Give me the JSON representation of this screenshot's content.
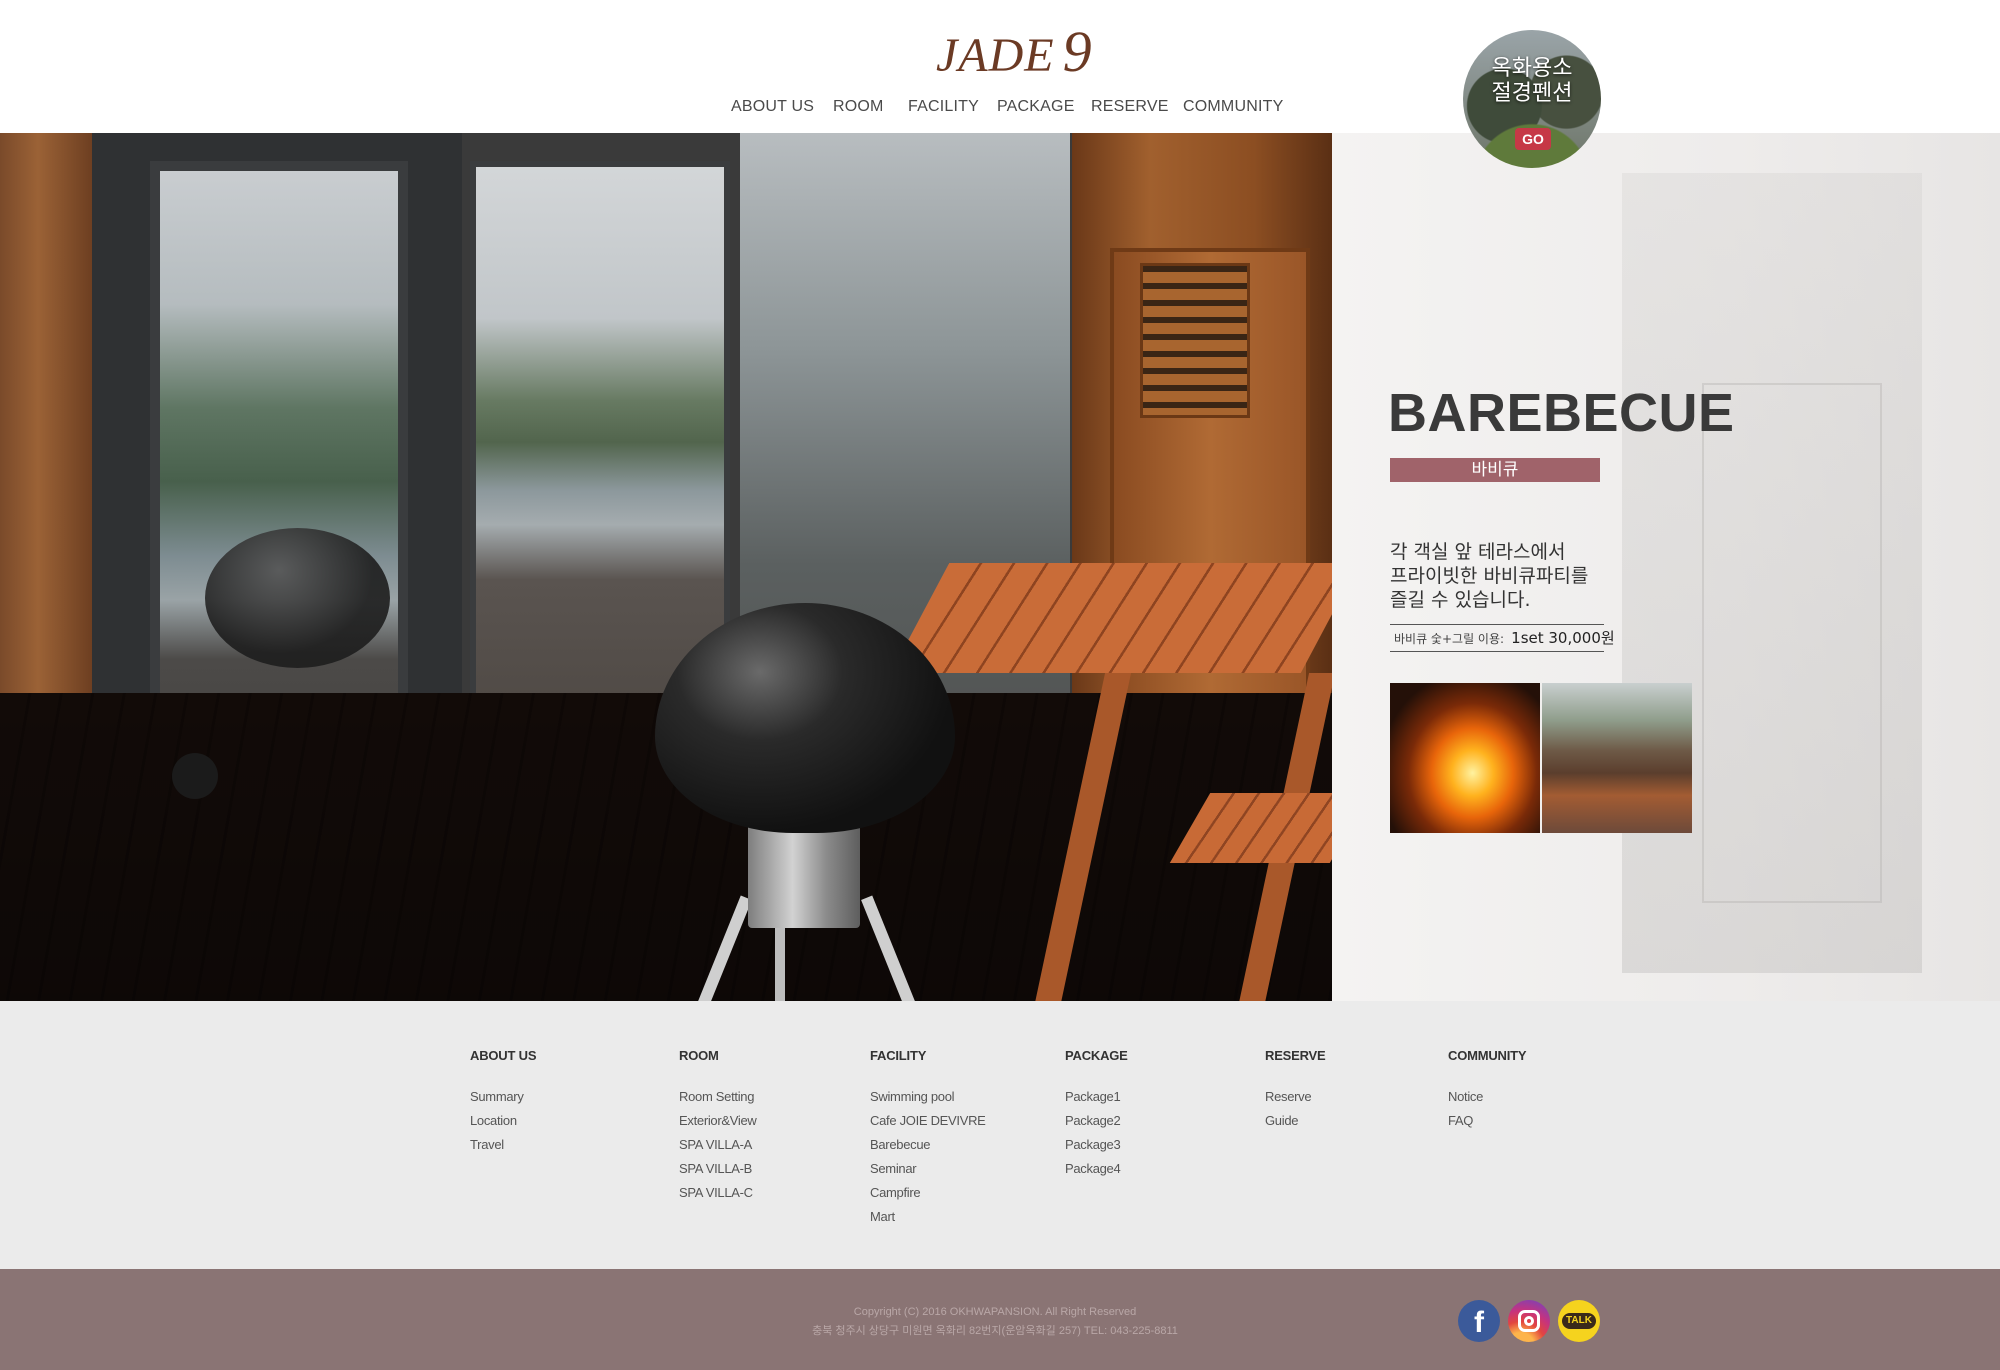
{
  "header": {
    "logo_word": "JADE",
    "logo_number": "9",
    "nav": [
      "ABOUT US",
      "ROOM",
      "FACILITY",
      "PACKAGE",
      "RESERVE",
      "COMMUNITY"
    ]
  },
  "promo": {
    "line1": "옥화용소",
    "line2": "절경펜션",
    "button": "GO"
  },
  "feature": {
    "title": "BAREBECUE",
    "subtitle": "바비큐",
    "description": [
      "각 객실 앞 테라스에서",
      "프라이빗한 바비큐파티를",
      "즐길 수 있습니다."
    ],
    "price_label": "바비큐 숯+그릴 이용:",
    "price_value": "1set 30,000원",
    "thumbnails": [
      "fire-thumbnail",
      "terrace-thumbnail"
    ]
  },
  "sitemap": [
    {
      "heading": "ABOUT US",
      "items": [
        "Summary",
        "Location",
        "Travel"
      ]
    },
    {
      "heading": "ROOM",
      "items": [
        "Room Setting",
        "Exterior&View",
        "SPA VILLA-A",
        "SPA VILLA-B",
        "SPA VILLA-C"
      ]
    },
    {
      "heading": "FACILITY",
      "items": [
        "Swimming pool",
        "Cafe JOIE DEVIVRE",
        "Barebecue",
        "Seminar",
        "Campfire",
        "Mart"
      ]
    },
    {
      "heading": "PACKAGE",
      "items": [
        "Package1",
        "Package2",
        "Package3",
        "Package4"
      ]
    },
    {
      "heading": "RESERVE",
      "items": [
        "Reserve",
        "Guide"
      ]
    },
    {
      "heading": "COMMUNITY",
      "items": [
        "Notice",
        "FAQ"
      ]
    }
  ],
  "footer": {
    "copyright": "Copyright (C) 2016 OKHWAPANSION. All Right Reserved",
    "address": "충북 청주시 상당구 미원면 옥화리 82번지(운암옥화길 257) TEL: 043-225-8811",
    "sns": {
      "facebook_glyph": "f",
      "talk_label": "TALK"
    }
  },
  "colors": {
    "logo": "#6b3a24",
    "badge": "#a0636a",
    "sitemap_bg": "#ebebeb",
    "bottom_bar": "#8a7474"
  }
}
